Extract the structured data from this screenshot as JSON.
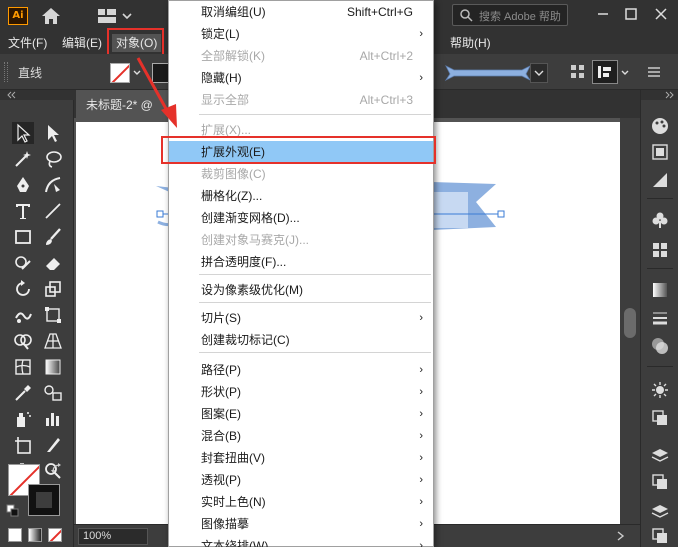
{
  "app": {
    "logo": "Ai",
    "search_placeholder": "搜索 Adobe 帮助"
  },
  "menubar": {
    "items": [
      {
        "label": "文件(F)"
      },
      {
        "label": "编辑(E)"
      },
      {
        "label": "对象(O)"
      },
      {
        "label": "帮助(H)"
      }
    ]
  },
  "control_bar": {
    "label": "直线"
  },
  "document": {
    "tab_label": "未标题-2* @",
    "zoom": "100%"
  },
  "object_menu": {
    "items": [
      {
        "label": "取消编组(U)",
        "shortcut": "Shift+Ctrl+G",
        "submenu": false,
        "enabled": true
      },
      {
        "label": "锁定(L)",
        "shortcut": "",
        "submenu": true,
        "enabled": true
      },
      {
        "label": "全部解锁(K)",
        "shortcut": "Alt+Ctrl+2",
        "submenu": false,
        "enabled": false
      },
      {
        "label": "隐藏(H)",
        "shortcut": "",
        "submenu": true,
        "enabled": true
      },
      {
        "label": "显示全部",
        "shortcut": "Alt+Ctrl+3",
        "submenu": false,
        "enabled": false
      },
      {
        "label": "扩展(X)...",
        "shortcut": "",
        "submenu": false,
        "enabled": false
      },
      {
        "label": "扩展外观(E)",
        "shortcut": "",
        "submenu": false,
        "enabled": true,
        "highlighted": true
      },
      {
        "label": "裁剪图像(C)",
        "shortcut": "",
        "submenu": false,
        "enabled": false
      },
      {
        "label": "栅格化(Z)...",
        "shortcut": "",
        "submenu": false,
        "enabled": true
      },
      {
        "label": "创建渐变网格(D)...",
        "shortcut": "",
        "submenu": false,
        "enabled": true
      },
      {
        "label": "创建对象马赛克(J)...",
        "shortcut": "",
        "submenu": false,
        "enabled": false
      },
      {
        "label": "拼合透明度(F)...",
        "shortcut": "",
        "submenu": false,
        "enabled": true
      },
      {
        "label": "设为像素级优化(M)",
        "shortcut": "",
        "submenu": false,
        "enabled": true
      },
      {
        "label": "切片(S)",
        "shortcut": "",
        "submenu": true,
        "enabled": true
      },
      {
        "label": "创建裁切标记(C)",
        "shortcut": "",
        "submenu": false,
        "enabled": true
      },
      {
        "label": "路径(P)",
        "shortcut": "",
        "submenu": true,
        "enabled": true
      },
      {
        "label": "形状(P)",
        "shortcut": "",
        "submenu": true,
        "enabled": true
      },
      {
        "label": "图案(E)",
        "shortcut": "",
        "submenu": true,
        "enabled": true
      },
      {
        "label": "混合(B)",
        "shortcut": "",
        "submenu": true,
        "enabled": true
      },
      {
        "label": "封套扭曲(V)",
        "shortcut": "",
        "submenu": true,
        "enabled": true
      },
      {
        "label": "透视(P)",
        "shortcut": "",
        "submenu": true,
        "enabled": true
      },
      {
        "label": "实时上色(N)",
        "shortcut": "",
        "submenu": true,
        "enabled": true
      },
      {
        "label": "图像描摹",
        "shortcut": "",
        "submenu": true,
        "enabled": true
      },
      {
        "label": "文本绕排(W)",
        "shortcut": "",
        "submenu": true,
        "enabled": true
      }
    ],
    "arrow_glyph": "›"
  },
  "colors": {
    "highlight": "#90c8f6",
    "annotation_red": "#e5312a",
    "ribbon": "#8db0e0"
  }
}
